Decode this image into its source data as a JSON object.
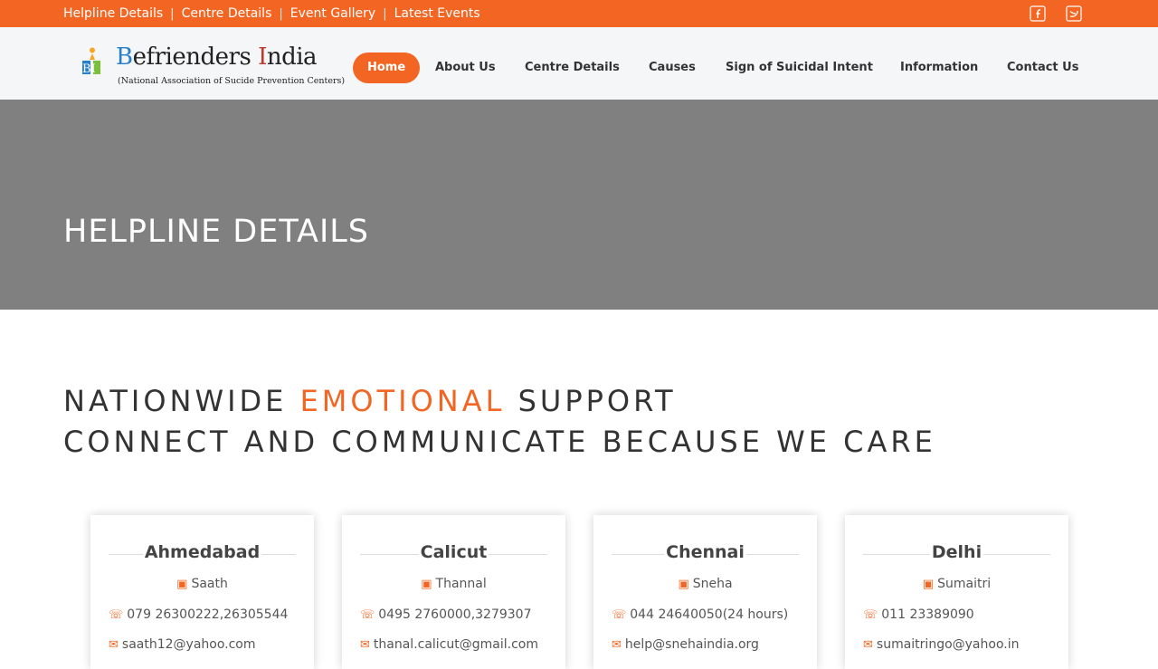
{
  "topbar": {
    "links": [
      "Helpline Details",
      "Centre Details",
      "Event Gallery",
      "Latest Events"
    ],
    "social": [
      "facebook-icon",
      "twitter-icon"
    ]
  },
  "brand": {
    "mark": "BI",
    "title_b": "B",
    "title_mid": "efrienders ",
    "title_i": "I",
    "title_end": "ndia",
    "subtitle": "(National Association of Sucide Prevention Centers)"
  },
  "nav": [
    "Home",
    "About Us",
    "Centre Details",
    "Causes",
    "Sign of Suicidal Intent",
    "Information",
    "Contact Us"
  ],
  "hero": {
    "title": "HELPLINE DETAILS"
  },
  "section": {
    "line1_pre": "NATIONWIDE ",
    "line1_accent": "EMOTIONAL",
    "line1_post": " SUPPORT",
    "line2": "CONNECT AND COMMUNICATE BECAUSE WE CARE"
  },
  "centres": [
    {
      "city": "Ahmedabad",
      "org": "Saath",
      "phone": "079 26300222,26305544",
      "email": "saath12@yahoo.com"
    },
    {
      "city": "Calicut",
      "org": "Thannal",
      "phone": "0495 2760000,3279307",
      "email": "thanal.calicut@gmail.com"
    },
    {
      "city": "Chennai",
      "org": "Sneha",
      "phone": "044 24640050(24 hours)",
      "email": "help@snehaindia.org"
    },
    {
      "city": "Delhi",
      "org": "Sumaitri",
      "phone": "011 23389090",
      "email": "sumaitringo@yahoo.in"
    }
  ],
  "colors": {
    "accent": "#f26522",
    "hero_bg": "#808080"
  }
}
